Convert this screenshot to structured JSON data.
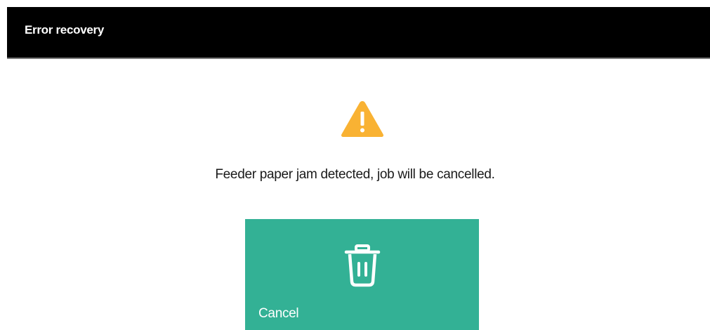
{
  "dialog": {
    "title": "Error recovery",
    "message": "Feeder paper jam detected, job will be cancelled.",
    "status_icon": "warning-icon"
  },
  "actions": {
    "cancel_label": "Cancel",
    "cancel_icon": "trash-icon"
  },
  "colors": {
    "title_bar": "#000000",
    "warning": "#f9b233",
    "action_tile": "#33b195"
  }
}
